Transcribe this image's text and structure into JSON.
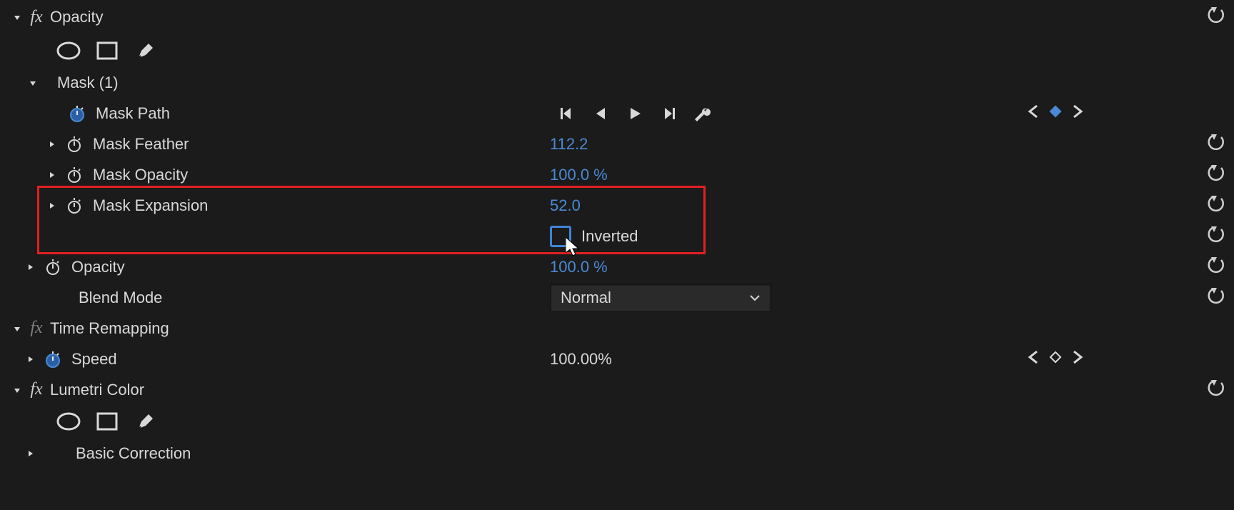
{
  "opacity": {
    "title": "Opacity",
    "mask": {
      "title": "Mask (1)",
      "path_label": "Mask Path",
      "feather_label": "Mask Feather",
      "feather_value": "112.2",
      "opacity_label": "Mask Opacity",
      "opacity_value": "100.0 %",
      "expansion_label": "Mask Expansion",
      "expansion_value": "52.0",
      "inverted_label": "Inverted"
    },
    "opacity_label": "Opacity",
    "opacity_value": "100.0 %",
    "blend_label": "Blend Mode",
    "blend_value": "Normal"
  },
  "time_remapping": {
    "title": "Time Remapping",
    "speed_label": "Speed",
    "speed_value": "100.00%"
  },
  "lumetri": {
    "title": "Lumetri Color",
    "basic_label": "Basic Correction"
  }
}
